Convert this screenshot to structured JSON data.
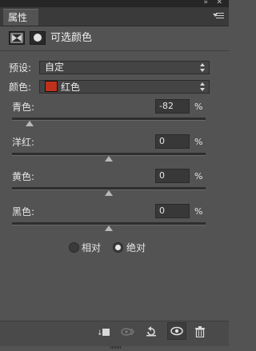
{
  "panel": {
    "tab_label": "属性",
    "top_icons": {
      "collapse": "double-chevron-right-icon",
      "close": "close-icon"
    },
    "menu_icon": "panel-menu-icon"
  },
  "header": {
    "title": "可选颜色",
    "icons": [
      "adjustment-layer-icon",
      "layer-mask-icon"
    ]
  },
  "preset": {
    "label": "预设:",
    "value": "自定"
  },
  "colors": {
    "label": "颜色:",
    "value": "红色",
    "swatch_color": "#c0311c"
  },
  "sliders": [
    {
      "label": "青色:",
      "value": "-82",
      "unit": "%",
      "level": -82
    },
    {
      "label": "洋红:",
      "value": "0",
      "unit": "%",
      "level": 0
    },
    {
      "label": "黄色:",
      "value": "0",
      "unit": "%",
      "level": 0
    },
    {
      "label": "黑色:",
      "value": "0",
      "unit": "%",
      "level": 0
    }
  ],
  "method": {
    "options": [
      {
        "label": "相对",
        "selected": false
      },
      {
        "label": "绝对",
        "selected": true
      }
    ]
  },
  "bottom_toolbar": {
    "icons": [
      "clip-to-layer-icon",
      "view-previous-state-icon",
      "reset-icon",
      "visibility-eye-icon",
      "trash-icon"
    ]
  }
}
